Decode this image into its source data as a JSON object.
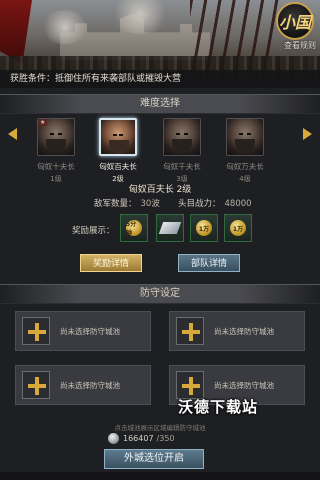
{
  "header": {
    "guide_badge": "小国",
    "guide_label": "查看规则",
    "victory_condition": "获胜条件：抵御住所有来袭部队或摧毁大营"
  },
  "difficulty": {
    "title": "难度选择",
    "bosses": [
      {
        "name": "匈奴十夫长",
        "level": "1级"
      },
      {
        "name": "匈奴百夫长",
        "level": "2级"
      },
      {
        "name": "匈奴千夫长",
        "level": "3级"
      },
      {
        "name": "匈奴万夫长",
        "level": "4级"
      }
    ],
    "selected_title": "匈奴百夫长  2级",
    "enemy_count_label": "敌军数量：",
    "enemy_count_value": "30波",
    "boss_power_label": "头目战力：",
    "boss_power_value": "48000",
    "rewards_label": "奖励展示：",
    "rewards": [
      {
        "text": "5分钟",
        "icon": "speedup-coin-icon"
      },
      {
        "text": "",
        "icon": "iron-plate-icon"
      },
      {
        "text": "1万",
        "icon": "resource-coin-icon"
      },
      {
        "text": "1万",
        "icon": "resource-coin-icon"
      }
    ],
    "reward_detail_button": "奖励详情",
    "troop_detail_button": "部队详情"
  },
  "defense": {
    "title": "防守设定",
    "slot_label": "尚未选择防守城池",
    "hint": "点击城池展示区域编辑防守城池",
    "silver_value": "166407",
    "silver_cap": "/350",
    "start_button": "外城选位开启"
  },
  "watermark": "沃德下载站",
  "colors": {
    "accent_gold": "#d8a83a",
    "button_blue": "#4a6272",
    "background": "#1e1f22"
  }
}
